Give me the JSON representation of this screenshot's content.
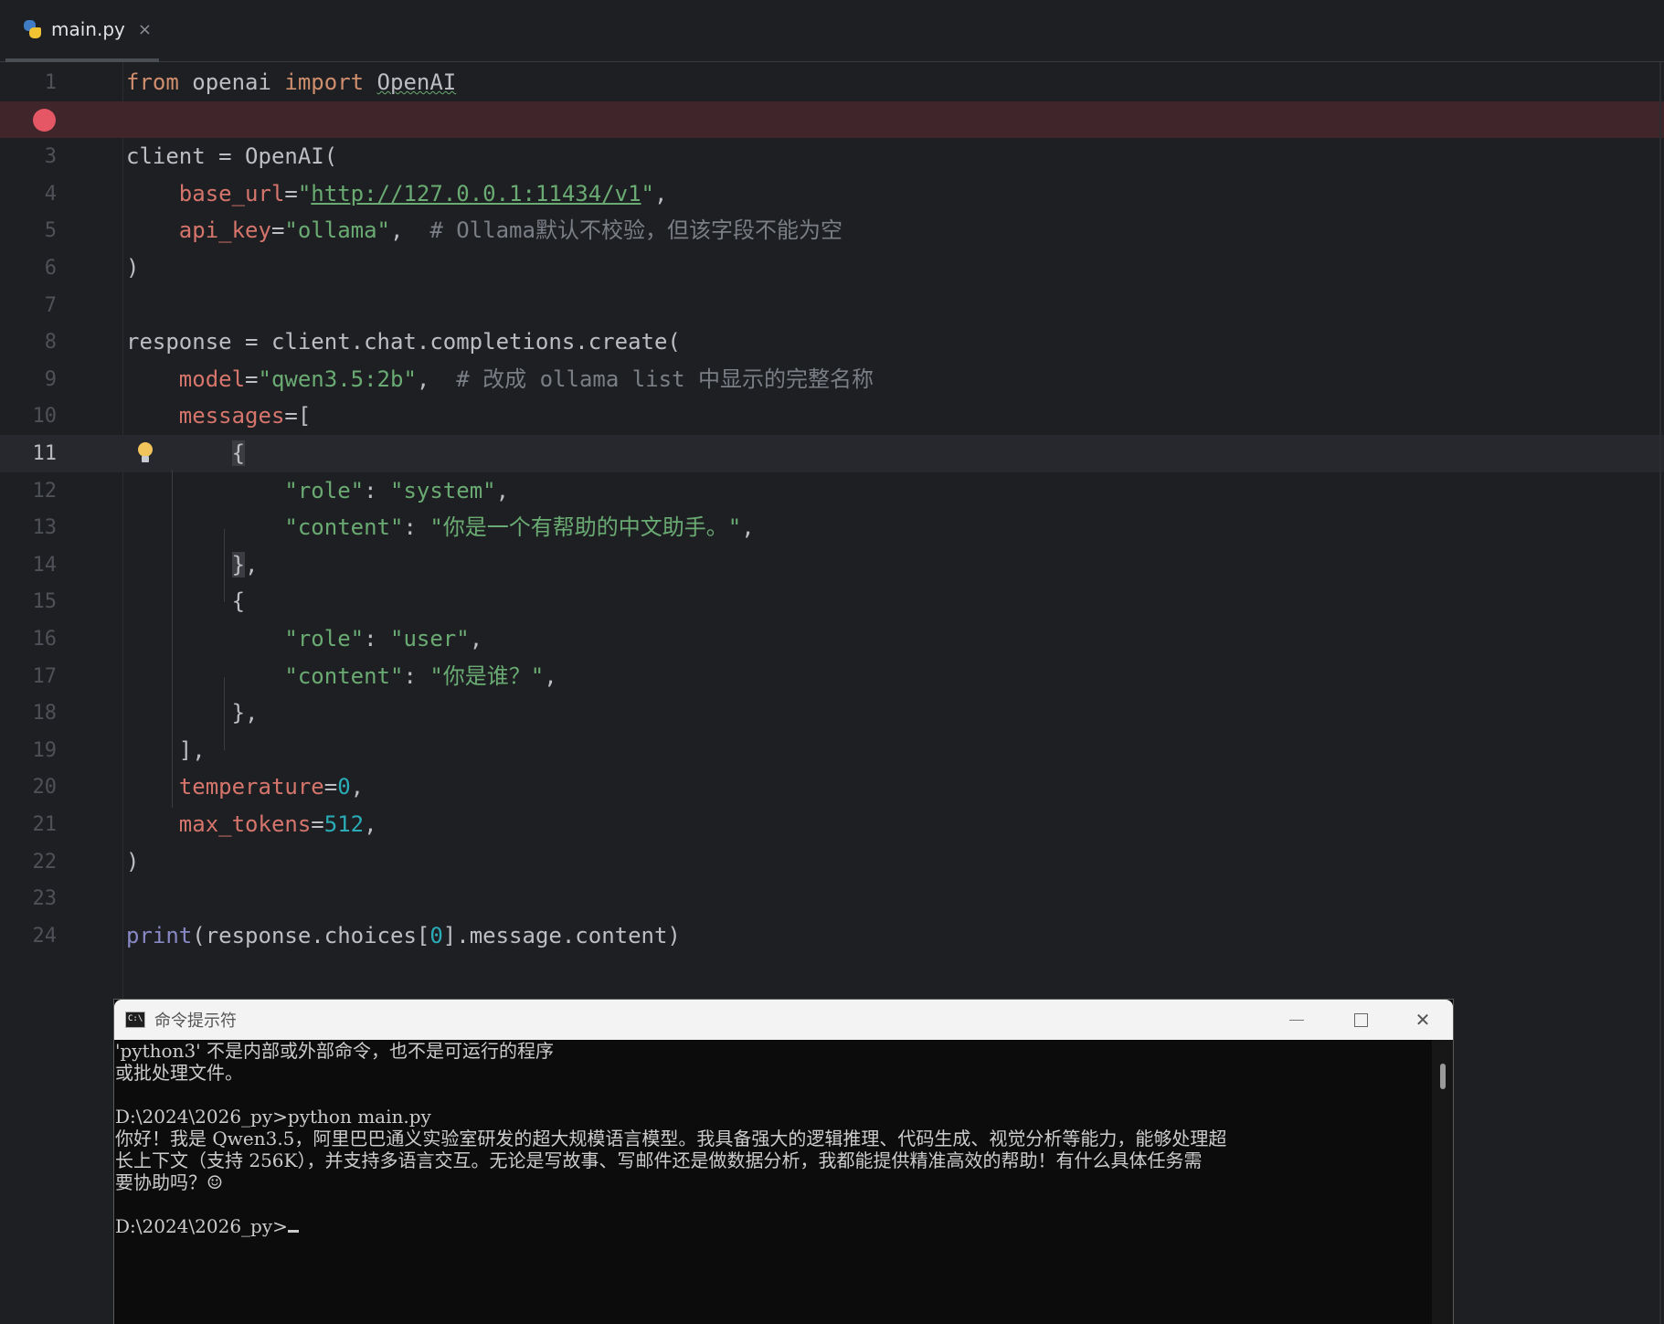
{
  "tab": {
    "label": "main.py",
    "close": "×",
    "icon": "python-file-icon"
  },
  "code_lines": [
    {
      "n": "1",
      "segments": [
        {
          "t": "from",
          "c": "kw"
        },
        {
          "t": " openai ",
          "c": ""
        },
        {
          "t": "import",
          "c": "kw"
        },
        {
          "t": " ",
          "c": ""
        },
        {
          "t": "OpenAI",
          "c": "typo"
        }
      ]
    },
    {
      "n": "2",
      "breakpoint": true,
      "segments": []
    },
    {
      "n": "3",
      "segments": [
        {
          "t": "client = OpenAI(",
          "c": ""
        }
      ]
    },
    {
      "n": "4",
      "segments": [
        {
          "t": "    ",
          "c": ""
        },
        {
          "t": "base_url",
          "c": "param"
        },
        {
          "t": "=",
          "c": ""
        },
        {
          "t": "\"",
          "c": "str"
        },
        {
          "t": "http://127.0.0.1:11434/v1",
          "c": "url"
        },
        {
          "t": "\"",
          "c": "str"
        },
        {
          "t": ",",
          "c": ""
        }
      ]
    },
    {
      "n": "5",
      "segments": [
        {
          "t": "    ",
          "c": ""
        },
        {
          "t": "api_key",
          "c": "param"
        },
        {
          "t": "=",
          "c": ""
        },
        {
          "t": "\"ollama\"",
          "c": "str"
        },
        {
          "t": ",  ",
          "c": ""
        },
        {
          "t": "# Ollama默认不校验，但该字段不能为空",
          "c": "cmt"
        }
      ]
    },
    {
      "n": "6",
      "segments": [
        {
          "t": ")",
          "c": ""
        }
      ]
    },
    {
      "n": "7",
      "segments": []
    },
    {
      "n": "8",
      "segments": [
        {
          "t": "response = client.chat.completions.create(",
          "c": ""
        }
      ]
    },
    {
      "n": "9",
      "segments": [
        {
          "t": "    ",
          "c": ""
        },
        {
          "t": "model",
          "c": "param"
        },
        {
          "t": "=",
          "c": ""
        },
        {
          "t": "\"qwen3.5:2b\"",
          "c": "str"
        },
        {
          "t": ",  ",
          "c": ""
        },
        {
          "t": "# 改成 ollama list 中显示的完整名称",
          "c": "cmt"
        }
      ]
    },
    {
      "n": "10",
      "segments": [
        {
          "t": "    ",
          "c": ""
        },
        {
          "t": "messages",
          "c": "param"
        },
        {
          "t": "=[",
          "c": ""
        }
      ]
    },
    {
      "n": "11",
      "current": true,
      "bulb": true,
      "segments": [
        {
          "t": "        ",
          "c": ""
        },
        {
          "t": "{",
          "c": "brace-hl"
        }
      ]
    },
    {
      "n": "12",
      "segments": [
        {
          "t": "            ",
          "c": ""
        },
        {
          "t": "\"role\"",
          "c": "str"
        },
        {
          "t": ": ",
          "c": ""
        },
        {
          "t": "\"system\"",
          "c": "str"
        },
        {
          "t": ",",
          "c": ""
        }
      ]
    },
    {
      "n": "13",
      "segments": [
        {
          "t": "            ",
          "c": ""
        },
        {
          "t": "\"content\"",
          "c": "str"
        },
        {
          "t": ": ",
          "c": ""
        },
        {
          "t": "\"你是一个有帮助的中文助手。\"",
          "c": "str"
        },
        {
          "t": ",",
          "c": ""
        }
      ]
    },
    {
      "n": "14",
      "segments": [
        {
          "t": "        ",
          "c": ""
        },
        {
          "t": "}",
          "c": "brace-hl"
        },
        {
          "t": ",",
          "c": ""
        }
      ]
    },
    {
      "n": "15",
      "segments": [
        {
          "t": "        {",
          "c": ""
        }
      ]
    },
    {
      "n": "16",
      "segments": [
        {
          "t": "            ",
          "c": ""
        },
        {
          "t": "\"role\"",
          "c": "str"
        },
        {
          "t": ": ",
          "c": ""
        },
        {
          "t": "\"user\"",
          "c": "str"
        },
        {
          "t": ",",
          "c": ""
        }
      ]
    },
    {
      "n": "17",
      "segments": [
        {
          "t": "            ",
          "c": ""
        },
        {
          "t": "\"content\"",
          "c": "str"
        },
        {
          "t": ": ",
          "c": ""
        },
        {
          "t": "\"你是谁？\"",
          "c": "str"
        },
        {
          "t": ",",
          "c": ""
        }
      ]
    },
    {
      "n": "18",
      "segments": [
        {
          "t": "        },",
          "c": ""
        }
      ]
    },
    {
      "n": "19",
      "segments": [
        {
          "t": "    ],",
          "c": ""
        }
      ]
    },
    {
      "n": "20",
      "segments": [
        {
          "t": "    ",
          "c": ""
        },
        {
          "t": "temperature",
          "c": "param"
        },
        {
          "t": "=",
          "c": ""
        },
        {
          "t": "0",
          "c": "num"
        },
        {
          "t": ",",
          "c": ""
        }
      ]
    },
    {
      "n": "21",
      "segments": [
        {
          "t": "    ",
          "c": ""
        },
        {
          "t": "max_tokens",
          "c": "param"
        },
        {
          "t": "=",
          "c": ""
        },
        {
          "t": "512",
          "c": "num"
        },
        {
          "t": ",",
          "c": ""
        }
      ]
    },
    {
      "n": "22",
      "segments": [
        {
          "t": ")",
          "c": ""
        }
      ]
    },
    {
      "n": "23",
      "segments": []
    },
    {
      "n": "24",
      "segments": [
        {
          "t": "print",
          "c": "builtin"
        },
        {
          "t": "(response.choices[",
          "c": ""
        },
        {
          "t": "0",
          "c": "num"
        },
        {
          "t": "].message.content)",
          "c": ""
        }
      ]
    }
  ],
  "cmd": {
    "title": "命令提示符",
    "icon_text": "C:\\",
    "lines": [
      "'python3' 不是内部或外部命令，也不是可运行的程序",
      "或批处理文件。",
      "",
      "D:\\2024\\2026_py>python main.py",
      "你好！我是 Qwen3.5，阿里巴巴通义实验室研发的超大规模语言模型。我具备强大的逻辑推理、代码生成、视觉分析等能力，能够处理超",
      "长上下文（支持 256K），并支持多语言交互。无论是写故事、写邮件还是做数据分析，我都能提供精准高效的帮助！有什么具体任务需",
      "要协助吗？☺",
      ""
    ],
    "prompt": "D:\\2024\\2026_py>"
  }
}
